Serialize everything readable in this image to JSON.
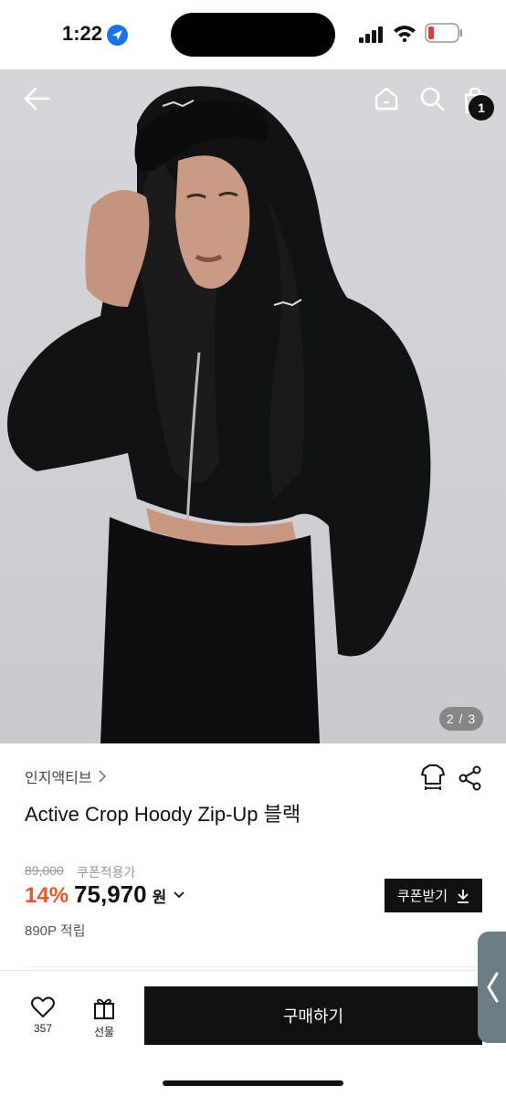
{
  "status_bar": {
    "time": "1:22"
  },
  "hero": {
    "page_indicator": "2 / 3",
    "cart_count": "1"
  },
  "product": {
    "brand": "인지액티브",
    "title": "Active Crop Hoody Zip-Up 블랙",
    "original_price": "89,000",
    "coupon_label": "쿠폰적용가",
    "discount": "14%",
    "price": "75,970",
    "currency": "원",
    "coupon_button": "쿠폰받기",
    "points": "890P 적립"
  },
  "bottom_bar": {
    "like_count": "357",
    "gift_label": "선물",
    "buy_label": "구매하기"
  },
  "colors": {
    "accent": "#e2572b",
    "dark": "#111111",
    "side_tab": "#6d7d85"
  },
  "icons": [
    "location-arrow-icon",
    "signal-icon",
    "wifi-icon",
    "battery-icon",
    "back-arrow-icon",
    "home-icon",
    "search-icon",
    "shopping-bag-icon",
    "chevron-right-icon",
    "size-guide-icon",
    "share-icon",
    "chevron-down-icon",
    "download-icon",
    "heart-icon",
    "gift-icon",
    "chevron-left-icon"
  ]
}
